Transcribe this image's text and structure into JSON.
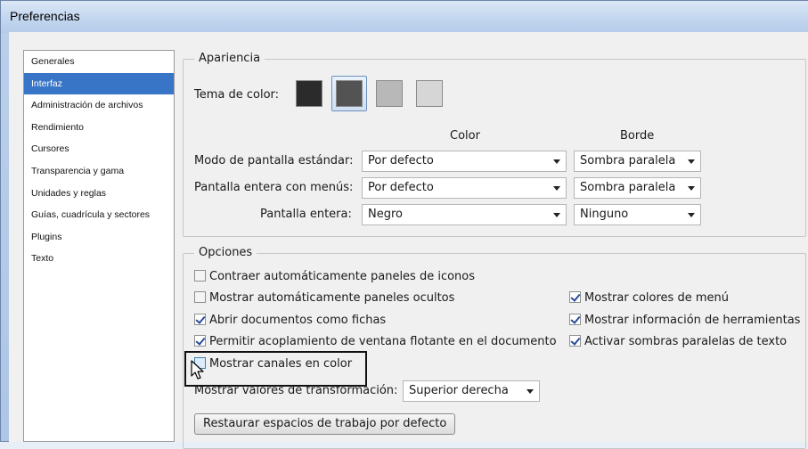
{
  "window": {
    "title": "Preferencias"
  },
  "sidebar": {
    "items": [
      {
        "label": "Generales",
        "selected": false
      },
      {
        "label": "Interfaz",
        "selected": true
      },
      {
        "label": "Administración de archivos",
        "selected": false
      },
      {
        "label": "Rendimiento",
        "selected": false
      },
      {
        "label": "Cursores",
        "selected": false
      },
      {
        "label": "Transparencia y gama",
        "selected": false
      },
      {
        "label": "Unidades y reglas",
        "selected": false
      },
      {
        "label": "Guías, cuadrícula y sectores",
        "selected": false
      },
      {
        "label": "Plugins",
        "selected": false
      },
      {
        "label": "Texto",
        "selected": false
      }
    ]
  },
  "apariencia": {
    "legend": "Apariencia",
    "tema_label": "Tema de color:",
    "swatches": [
      "#2b2b2b",
      "#535353",
      "#b8b8b8",
      "#d6d6d6"
    ],
    "selected_swatch": 1,
    "col_color": "Color",
    "col_borde": "Borde",
    "rows": [
      {
        "label": "Modo de pantalla estándar:",
        "color": "Por defecto",
        "borde": "Sombra paralela"
      },
      {
        "label": "Pantalla entera con menús:",
        "color": "Por defecto",
        "borde": "Sombra paralela"
      },
      {
        "label": "Pantalla entera:",
        "color": "Negro",
        "borde": "Ninguno"
      }
    ]
  },
  "opciones": {
    "legend": "Opciones",
    "checkboxes": [
      {
        "label": "Contraer automáticamente paneles de iconos",
        "checked": false
      },
      {
        "label": "Mostrar automáticamente paneles ocultos",
        "checked": false
      },
      {
        "label": "Abrir documentos como fichas",
        "checked": true
      },
      {
        "label": "Permitir acoplamiento de ventana flotante en el documento",
        "checked": true
      },
      {
        "label": "Mostrar canales en color",
        "checked": false
      },
      {
        "label": "Mostrar colores de menú",
        "checked": true
      },
      {
        "label": "Mostrar información de herramientas",
        "checked": true
      },
      {
        "label": "Activar sombras paralelas de texto",
        "checked": true
      }
    ],
    "transform_label": "Mostrar valores de transformación:",
    "transform_value": "Superior derecha",
    "restore_button": "Restaurar espacios de trabajo por defecto"
  }
}
